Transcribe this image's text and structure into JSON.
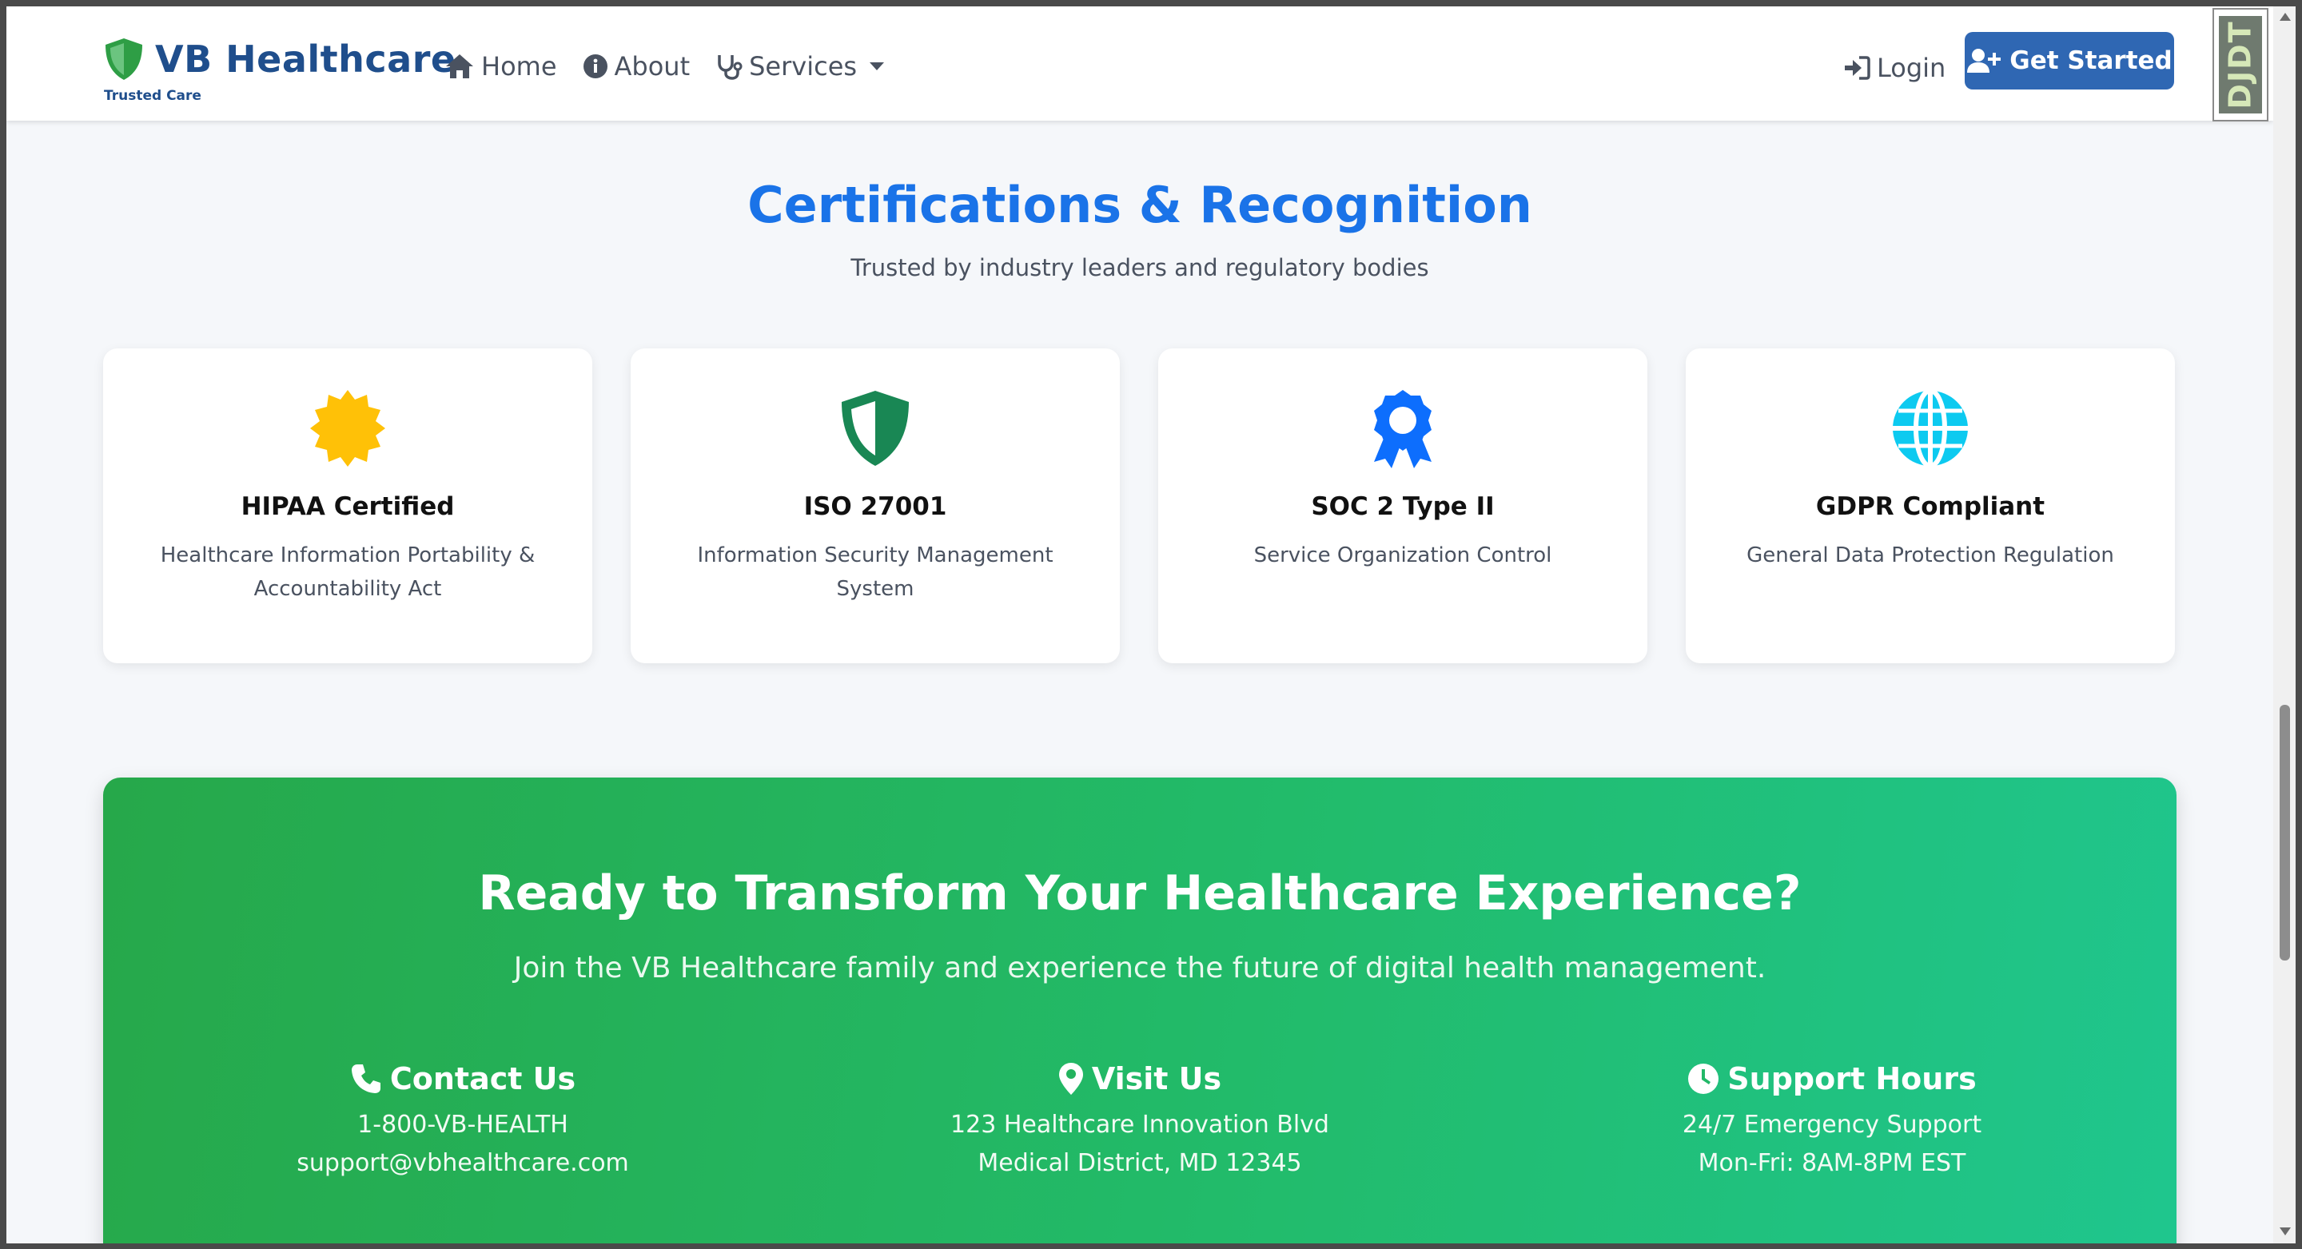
{
  "navbar": {
    "brand_name": "VB Healthcare",
    "brand_tagline": "Trusted Care",
    "links": [
      {
        "label": "Home",
        "icon": "home-icon"
      },
      {
        "label": "About",
        "icon": "info-circle-icon"
      },
      {
        "label": "Services",
        "icon": "stethoscope-icon"
      }
    ],
    "login_label": "Login",
    "cta_label": "Get Started",
    "extension_badge": "DJDT"
  },
  "certifications": {
    "title": "Certifications & Recognition",
    "subtitle": "Trusted by industry leaders and regulatory bodies",
    "cards": [
      {
        "title": "HIPAA Certified",
        "description": "Healthcare Information Portability & Accountability Act",
        "icon": "certificate-icon",
        "color": "#ffc107"
      },
      {
        "title": "ISO 27001",
        "description": "Information Security Management System",
        "icon": "shield-icon",
        "color": "#198754"
      },
      {
        "title": "SOC 2 Type II",
        "description": "Service Organization Control",
        "icon": "award-icon",
        "color": "#0d6efd"
      },
      {
        "title": "GDPR Compliant",
        "description": "General Data Protection Regulation",
        "icon": "globe-icon",
        "color": "#0dcaf0"
      }
    ]
  },
  "cta": {
    "title": "Ready to Transform Your Healthcare Experience?",
    "subtitle": "Join the VB Healthcare family and experience the future of digital health management.",
    "columns": [
      {
        "heading": "Contact Us",
        "icon": "phone-icon",
        "lines": [
          "1-800-VB-HEALTH",
          "support@vbhealthcare.com"
        ]
      },
      {
        "heading": "Visit Us",
        "icon": "map-pin-icon",
        "lines": [
          "123 Healthcare Innovation Blvd",
          "Medical District, MD 12345"
        ]
      },
      {
        "heading": "Support Hours",
        "icon": "clock-icon",
        "lines": [
          "24/7 Emergency Support",
          "Mon-Fri: 8AM-8PM EST"
        ]
      }
    ]
  },
  "colors": {
    "brand": "#1f4e8c",
    "title_blue": "#1a73e8",
    "button": "#2f67b3",
    "cta_green": "#22bb6a"
  }
}
